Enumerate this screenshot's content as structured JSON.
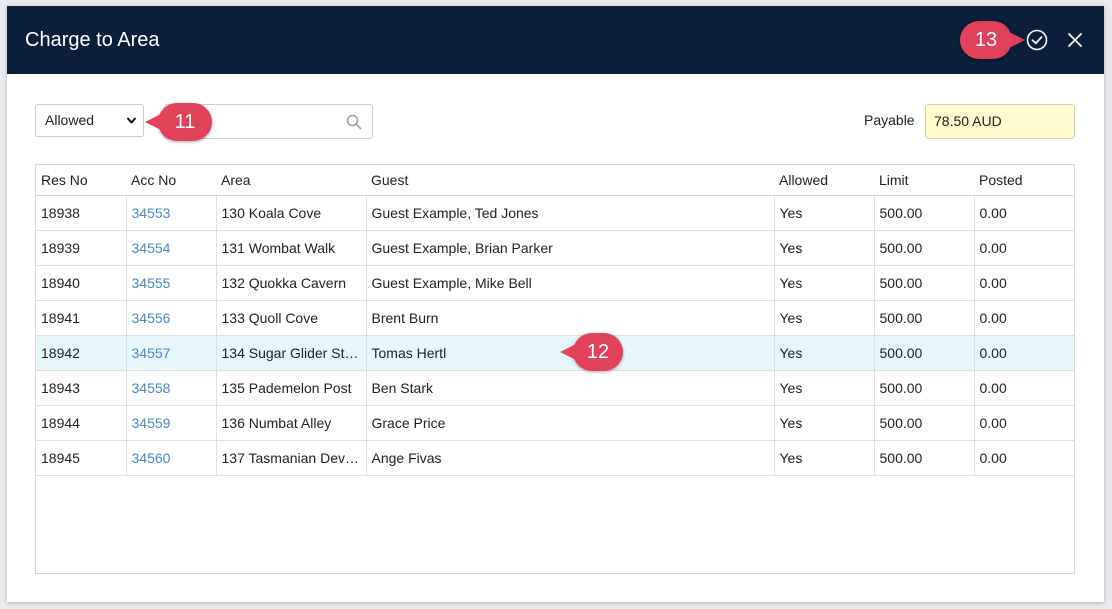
{
  "dialog": {
    "title": "Charge to Area"
  },
  "callouts": {
    "c11": "11",
    "c12": "12",
    "c13": "13"
  },
  "filter": {
    "selected": "Allowed"
  },
  "search": {
    "value": ""
  },
  "payable": {
    "label": "Payable",
    "value": "78.50 AUD"
  },
  "table": {
    "headers": [
      "Res No",
      "Acc No",
      "Area",
      "Guest",
      "Allowed",
      "Limit",
      "Posted"
    ],
    "rows": [
      [
        "18938",
        "34553",
        "130 Koala Cove",
        "Guest Example, Ted Jones",
        "Yes",
        "500.00",
        "0.00"
      ],
      [
        "18939",
        "34554",
        "131 Wombat Walk",
        "Guest Example, Brian Parker",
        "Yes",
        "500.00",
        "0.00"
      ],
      [
        "18940",
        "34555",
        "132 Quokka Cavern",
        "Guest Example, Mike Bell",
        "Yes",
        "500.00",
        "0.00"
      ],
      [
        "18941",
        "34556",
        "133 Quoll Cove",
        "Brent Burn",
        "Yes",
        "500.00",
        "0.00"
      ],
      [
        "18942",
        "34557",
        "134 Sugar Glider St…",
        "Tomas Hertl",
        "Yes",
        "500.00",
        "0.00"
      ],
      [
        "18943",
        "34558",
        "135 Pademelon Post",
        "Ben Stark",
        "Yes",
        "500.00",
        "0.00"
      ],
      [
        "18944",
        "34559",
        "136 Numbat Alley",
        "Grace Price",
        "Yes",
        "500.00",
        "0.00"
      ],
      [
        "18945",
        "34560",
        "137 Tasmanian Dev…",
        "Ange Fivas",
        "Yes",
        "500.00",
        "0.00"
      ]
    ]
  },
  "colors": {
    "titlebar": "#0c1f3a",
    "callout": "#e0425a",
    "link": "#4f86c6",
    "highlight_row": "#e6f6fb",
    "payable_bg": "#fff9cf"
  }
}
